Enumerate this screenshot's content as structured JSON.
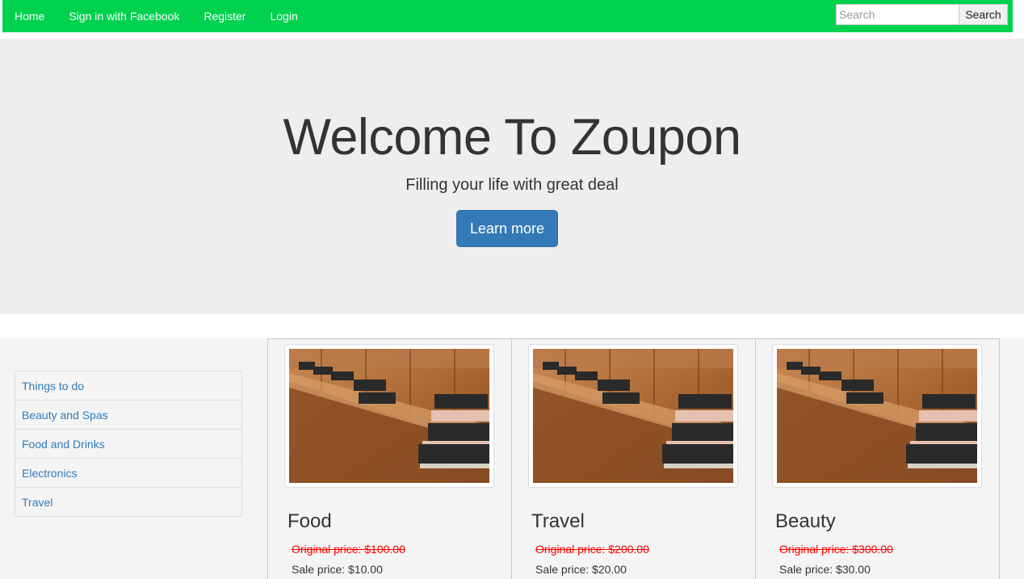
{
  "nav": {
    "links": [
      {
        "label": "Home"
      },
      {
        "label": "Sign in with Facebook"
      },
      {
        "label": "Register"
      },
      {
        "label": "Login"
      }
    ],
    "search": {
      "placeholder": "Search",
      "button_label": "Search"
    },
    "background_color": "#00d14f"
  },
  "hero": {
    "title": "Welcome To Zoupon",
    "subtitle": "Filling your life with great deal",
    "button_label": "Learn more",
    "button_color": "#337ab7"
  },
  "categories": [
    {
      "label": "Things to do"
    },
    {
      "label": "Beauty and Spas"
    },
    {
      "label": "Food and Drinks"
    },
    {
      "label": "Electronics"
    },
    {
      "label": "Travel"
    }
  ],
  "deals": [
    {
      "title": "Food",
      "original_price": "Original price: $100.00",
      "sale_price": "Sale price: $10.00",
      "image": "books-on-pew-photo"
    },
    {
      "title": "Travel",
      "original_price": "Original price: $200.00",
      "sale_price": "Sale price: $20.00",
      "image": "books-on-pew-photo"
    },
    {
      "title": "Beauty",
      "original_price": "Original price: $300.00",
      "sale_price": "Sale price: $30.00",
      "image": "books-on-pew-photo"
    }
  ]
}
